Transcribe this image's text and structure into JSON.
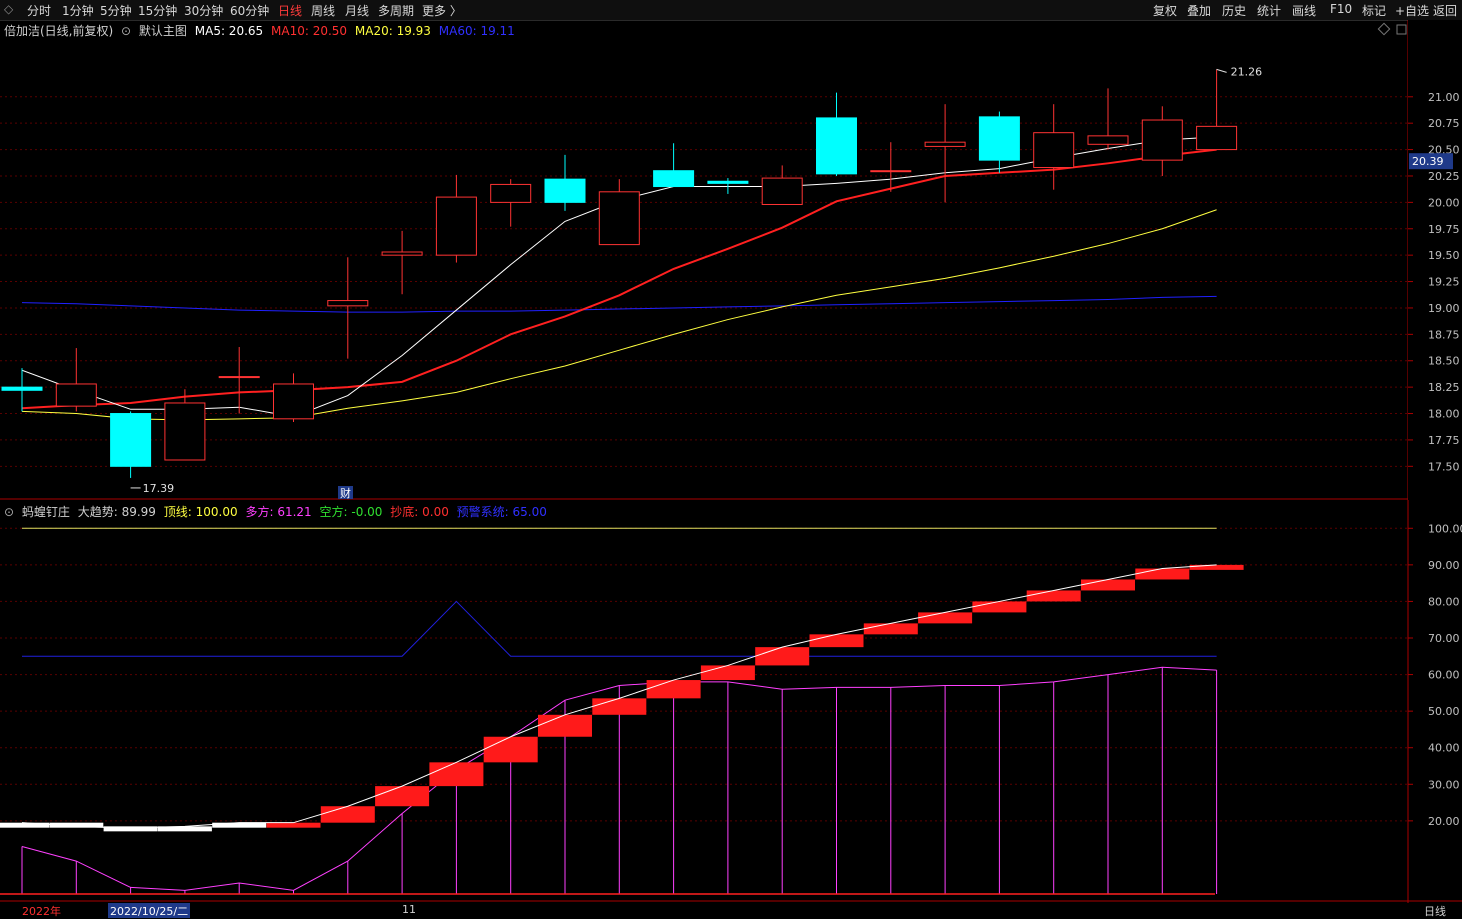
{
  "toolbar": {
    "left_items": [
      "分时",
      "1分钟",
      "5分钟",
      "15分钟",
      "30分钟",
      "60分钟",
      "日线",
      "周线",
      "月线",
      "多周期",
      "更多 〉"
    ],
    "active_item": "日线",
    "right_items": [
      "复权",
      "叠加",
      "历史",
      "统计",
      "画线",
      "F10",
      "标记",
      "+自选",
      "返回"
    ]
  },
  "main_legend": {
    "stock": "倍加洁(日线,前复权)",
    "chart_name": "默认主图",
    "ma5": "MA5: 20.65",
    "ma10": "MA10: 20.50",
    "ma20": "MA20: 19.93",
    "ma60": "MA60: 19.11"
  },
  "colors": {
    "up": "#ff3333",
    "down": "#00ffff",
    "ma5": "#ffffff",
    "ma10": "#ff2020",
    "ma20": "#ffff40",
    "ma60": "#2020ff",
    "bg": "#000000",
    "grid": "#5a0000",
    "border": "#aa0000",
    "magenta": "#ff40ff"
  },
  "indicator_legend": {
    "name": "蚂蝗钉庄",
    "trend": "大趋势: 89.99",
    "top": "顶线: 100.00",
    "long": "多方: 61.21",
    "short": "空方: -0.00",
    "bottom": "抄底: 0.00",
    "alert": "预警系统: 65.00"
  },
  "chart_data": [
    {
      "type": "candlestick",
      "ylim": [
        17.2,
        21.5
      ],
      "yticks": [
        "21.00",
        "20.75",
        "20.50",
        "20.25",
        "20.00",
        "19.75",
        "19.50",
        "19.25",
        "19.00",
        "18.75",
        "18.50",
        "18.25",
        "18.00",
        "17.75",
        "17.50"
      ],
      "current_price_label": "20.39",
      "high_label": "21.26",
      "low_label": "17.39",
      "event_marker": "财",
      "candles": [
        {
          "o": 18.25,
          "c": 18.22,
          "h": 18.43,
          "l": 18.02
        },
        {
          "o": 18.07,
          "c": 18.28,
          "h": 18.62,
          "l": 18.02
        },
        {
          "o": 18.0,
          "c": 17.5,
          "h": 18.02,
          "l": 17.39
        },
        {
          "o": 17.56,
          "c": 18.1,
          "h": 18.23,
          "l": 17.56
        },
        {
          "o": 18.35,
          "c": 18.35,
          "h": 18.63,
          "l": 18.0
        },
        {
          "o": 17.95,
          "c": 18.28,
          "h": 18.38,
          "l": 17.92
        },
        {
          "o": 19.02,
          "c": 19.07,
          "h": 19.48,
          "l": 18.52
        },
        {
          "o": 19.5,
          "c": 19.53,
          "h": 19.73,
          "l": 19.13
        },
        {
          "o": 19.5,
          "c": 20.05,
          "h": 20.26,
          "l": 19.43
        },
        {
          "o": 20.0,
          "c": 20.17,
          "h": 20.22,
          "l": 19.77
        },
        {
          "o": 20.22,
          "c": 20.0,
          "h": 20.45,
          "l": 19.92
        },
        {
          "o": 19.6,
          "c": 20.1,
          "h": 20.22,
          "l": 19.6
        },
        {
          "o": 20.3,
          "c": 20.15,
          "h": 20.56,
          "l": 20.15
        },
        {
          "o": 20.2,
          "c": 20.18,
          "h": 20.23,
          "l": 20.08
        },
        {
          "o": 19.98,
          "c": 20.23,
          "h": 20.35,
          "l": 19.98
        },
        {
          "o": 20.8,
          "c": 20.27,
          "h": 21.04,
          "l": 20.25
        },
        {
          "o": 20.3,
          "c": 20.3,
          "h": 20.57,
          "l": 20.1
        },
        {
          "o": 20.53,
          "c": 20.57,
          "h": 20.93,
          "l": 20.0
        },
        {
          "o": 20.81,
          "c": 20.4,
          "h": 20.86,
          "l": 20.28
        },
        {
          "o": 20.33,
          "c": 20.66,
          "h": 20.93,
          "l": 20.12
        },
        {
          "o": 20.55,
          "c": 20.63,
          "h": 21.08,
          "l": 20.5
        },
        {
          "o": 20.4,
          "c": 20.78,
          "h": 20.91,
          "l": 20.25
        },
        {
          "o": 20.5,
          "c": 20.72,
          "h": 21.26,
          "l": 20.5
        }
      ],
      "ma5": [
        18.41,
        18.22,
        18.04,
        18.04,
        18.06,
        17.97,
        18.17,
        18.55,
        18.98,
        19.41,
        19.82,
        20.02,
        20.15,
        20.15,
        20.15,
        20.18,
        20.22,
        20.28,
        20.32,
        20.42,
        20.51,
        20.59,
        20.62
      ],
      "ma10": [
        18.05,
        18.08,
        18.1,
        18.16,
        18.2,
        18.22,
        18.25,
        18.3,
        18.5,
        18.75,
        18.92,
        19.12,
        19.37,
        19.56,
        19.76,
        20.01,
        20.13,
        20.25,
        20.28,
        20.31,
        20.37,
        20.44,
        20.5
      ],
      "ma20": [
        18.02,
        18.0,
        17.95,
        17.94,
        17.95,
        17.96,
        18.05,
        18.12,
        18.2,
        18.33,
        18.45,
        18.6,
        18.75,
        18.89,
        19.01,
        19.12,
        19.2,
        19.28,
        19.38,
        19.49,
        19.61,
        19.75,
        19.93
      ],
      "ma60": [
        19.05,
        19.04,
        19.02,
        19.0,
        18.98,
        18.97,
        18.96,
        18.96,
        18.97,
        18.97,
        18.98,
        18.99,
        19.0,
        19.01,
        19.02,
        19.03,
        19.04,
        19.05,
        19.06,
        19.07,
        19.08,
        19.1,
        19.11
      ]
    },
    {
      "type": "bar",
      "ylim": [
        0,
        105
      ],
      "yticks": [
        "100.00",
        "90.00",
        "80.00",
        "70.00",
        "60.00",
        "50.00",
        "40.00",
        "30.00",
        "20.00"
      ],
      "series": [
        {
          "name": "大趋势",
          "values": [
            19.5,
            18.5,
            18.0,
            18.5,
            19.5,
            19.5,
            24.0,
            29.5,
            36.0,
            43.0,
            49.0,
            53.5,
            58.5,
            62.5,
            67.5,
            71.0,
            74.0,
            77.0,
            80.0,
            83.0,
            86.0,
            89.0,
            89.99
          ]
        },
        {
          "name": "多方",
          "values": [
            13.0,
            9.0,
            1.8,
            1.0,
            3.0,
            1.0,
            9.0,
            22.0,
            34.0,
            43.0,
            53.0,
            57.0,
            58.0,
            58.0,
            56.0,
            56.5,
            56.5,
            57.0,
            57.0,
            58.0,
            60.0,
            62.0,
            61.21
          ]
        },
        {
          "name": "顶线",
          "values": [
            100,
            100,
            100,
            100,
            100,
            100,
            100,
            100,
            100,
            100,
            100,
            100,
            100,
            100,
            100,
            100,
            100,
            100,
            100,
            100,
            100,
            100,
            100
          ]
        },
        {
          "name": "预警系统",
          "values": [
            65,
            65,
            65,
            65,
            65,
            65,
            65,
            65,
            80,
            65,
            65,
            65,
            65,
            65,
            65,
            65,
            65,
            65,
            65,
            65,
            65,
            65,
            65
          ]
        }
      ]
    }
  ],
  "status": {
    "year": "2022年",
    "date": "2022/10/25/二",
    "month": "11",
    "period": "日线"
  }
}
